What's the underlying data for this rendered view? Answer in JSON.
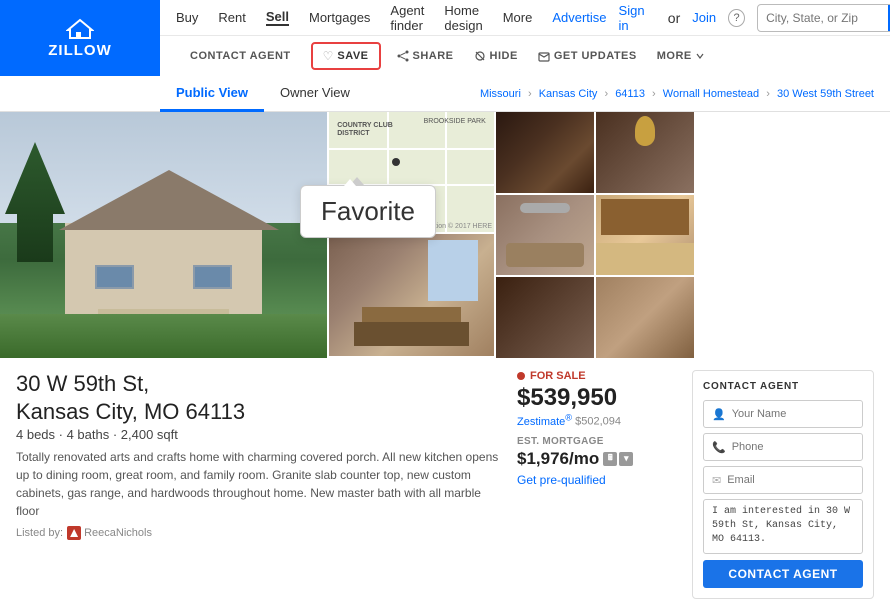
{
  "header": {
    "logo_text": "zillow",
    "logo_z": "Z",
    "nav": {
      "buy": "Buy",
      "rent": "Rent",
      "sell": "Sell",
      "mortgages": "Mortgages",
      "agent_finder": "Agent finder",
      "home_design": "Home design",
      "more": "More"
    },
    "right_nav": {
      "advertise": "Advertise",
      "sign_in": "Sign in",
      "or": "or",
      "join": "Join",
      "help_icon": "help-icon"
    },
    "search_placeholder": "City, State, or Zip",
    "action_bar": {
      "contact_agent": "CONTACT AGENT",
      "save": "SAVE",
      "share": "SHARE",
      "hide": "HIDE",
      "get_updates": "GET UPDATES",
      "more": "MORE"
    }
  },
  "tabs": {
    "public_view": "Public View",
    "owner_view": "Owner View"
  },
  "breadcrumb": {
    "state": "Missouri",
    "city": "Kansas City",
    "zip": "64113",
    "neighborhood": "Wornall Homestead",
    "address": "30 West 59th Street",
    "sep": "›"
  },
  "tooltip": {
    "label": "Favorite"
  },
  "property": {
    "address_line1": "30 W 59th St,",
    "address_line2": "Kansas City, MO 64113",
    "details": "4 beds · 4 baths · 2,400 sqft",
    "description": "Totally renovated arts and crafts home with charming covered porch. All new kitchen opens up to dining room, great room, and family room. Granite slab counter top, new custom cabinets, gas range, and hardwoods throughout home. New master bath with all marble floor",
    "listed_by": "Listed by:",
    "agent_name": "ReecaNichols"
  },
  "pricing": {
    "for_sale_label": "FOR SALE",
    "price": "$539,950",
    "zestimate_label": "Zestimate",
    "zestimate_symbol": "®",
    "zestimate_value": "$502,094",
    "est_mortgage_label": "EST. MORTGAGE",
    "est_mortgage_value": "$1,976/mo",
    "get_prequalified": "Get pre-qualified"
  },
  "contact_agent": {
    "title": "CONTACT AGENT",
    "name_placeholder": "Your Name",
    "phone_placeholder": "Phone",
    "email_placeholder": "Email",
    "message_default": "I am interested in 30 W 59th St, Kansas City, MO 64113.",
    "button_label": "Contact Agent"
  }
}
